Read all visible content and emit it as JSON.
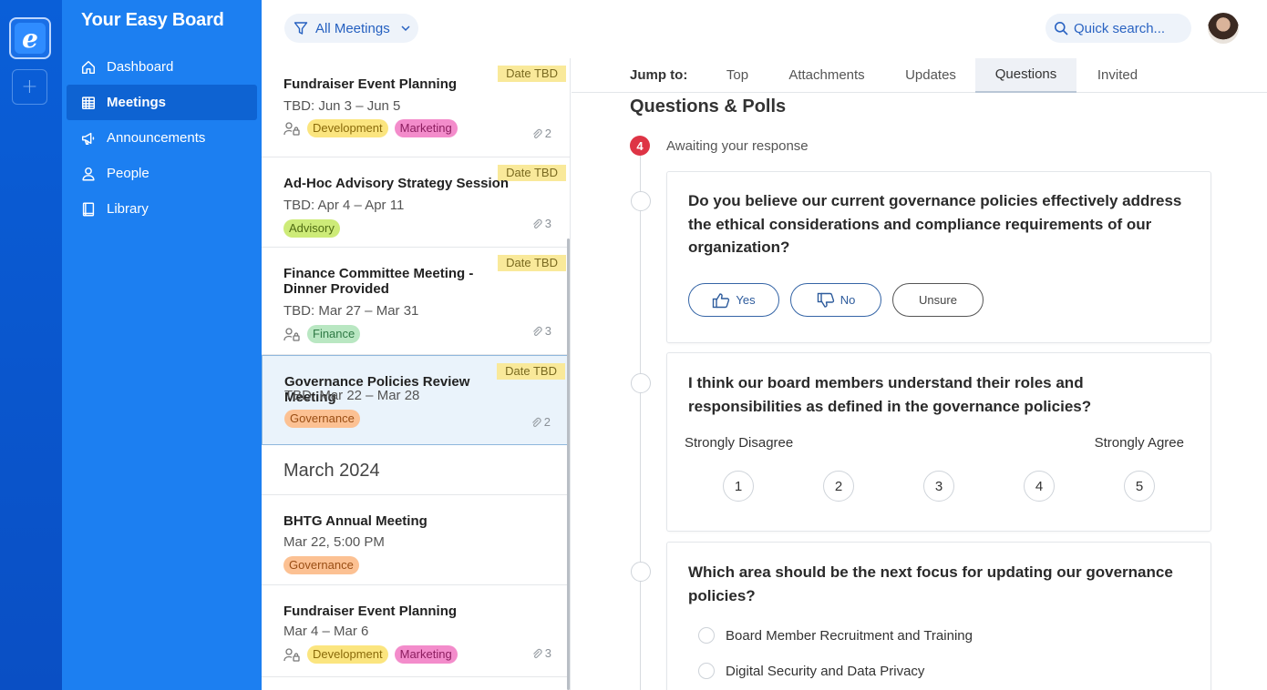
{
  "app": {
    "brand": "Your Easy Board",
    "logo_letter": "e",
    "add_symbol": "+"
  },
  "nav": [
    {
      "label": "Dashboard",
      "icon": "home-icon",
      "active": false
    },
    {
      "label": "Meetings",
      "icon": "calendar-icon",
      "active": true
    },
    {
      "label": "Announcements",
      "icon": "megaphone-icon",
      "active": false
    },
    {
      "label": "People",
      "icon": "person-icon",
      "active": false
    },
    {
      "label": "Library",
      "icon": "book-icon",
      "active": false
    }
  ],
  "topbar": {
    "filter_label": "All Meetings",
    "search_placeholder": "Quick search..."
  },
  "meetings": [
    {
      "title": "Fundraiser Event Planning",
      "date_badge": "Date TBD",
      "sub": "TBD: Jun 3 – Jun 5",
      "private": true,
      "tags": [
        {
          "label": "Development",
          "color": "yellow"
        },
        {
          "label": "Marketing",
          "color": "pink"
        }
      ],
      "attachments": "2"
    },
    {
      "title": "Ad-Hoc Advisory Strategy Session",
      "date_badge": "Date TBD",
      "sub": "TBD: Apr 4 – Apr 11",
      "private": false,
      "tags": [
        {
          "label": "Advisory",
          "color": "lime"
        }
      ],
      "attachments": "3"
    },
    {
      "title": "Finance Committee Meeting - Dinner Provided",
      "date_badge": "Date TBD",
      "sub": "TBD: Mar 27 – Mar 31",
      "private": true,
      "tags": [
        {
          "label": "Finance",
          "color": "green"
        }
      ],
      "attachments": "3"
    },
    {
      "title": "Governance Policies Review Meeting",
      "date_badge": "Date TBD",
      "sub": "TBD: Mar 22 – Mar 28",
      "private": false,
      "tags": [
        {
          "label": "Governance",
          "color": "orange"
        }
      ],
      "attachments": "2",
      "selected": true
    }
  ],
  "month_header": "March 2024",
  "meetings_march": [
    {
      "title": "BHTG Annual Meeting",
      "sub": "Mar 22, 5:00 PM",
      "private": false,
      "tags": [
        {
          "label": "Governance",
          "color": "orange"
        }
      ],
      "attachments": ""
    },
    {
      "title": "Fundraiser Event Planning",
      "sub": "Mar 4 – Mar 6",
      "private": true,
      "tags": [
        {
          "label": "Development",
          "color": "yellow"
        },
        {
          "label": "Marketing",
          "color": "pink"
        }
      ],
      "attachments": "3"
    }
  ],
  "detail": {
    "jump_label": "Jump to:",
    "tabs": [
      "Top",
      "Attachments",
      "Updates",
      "Questions",
      "Invited"
    ],
    "active_tab": "Questions",
    "section_title": "Questions & Polls",
    "awaiting_count": "4",
    "awaiting_text": "Awaiting your response",
    "questions": [
      {
        "text": "Do you believe our current governance policies effectively address the ethical considerations and compliance requirements of our organization?",
        "yes": "Yes",
        "no": "No",
        "unsure": "Unsure"
      },
      {
        "text": "I think our board members understand their roles and responsibilities as defined in the governance policies?",
        "low_label": "Strongly Disagree",
        "high_label": "Strongly Agree",
        "scale": [
          "1",
          "2",
          "3",
          "4",
          "5"
        ]
      },
      {
        "text": "Which area should be the next focus for updating our governance policies?",
        "options": [
          "Board Member Recruitment and Training",
          "Digital Security and Data Privacy"
        ]
      }
    ]
  }
}
